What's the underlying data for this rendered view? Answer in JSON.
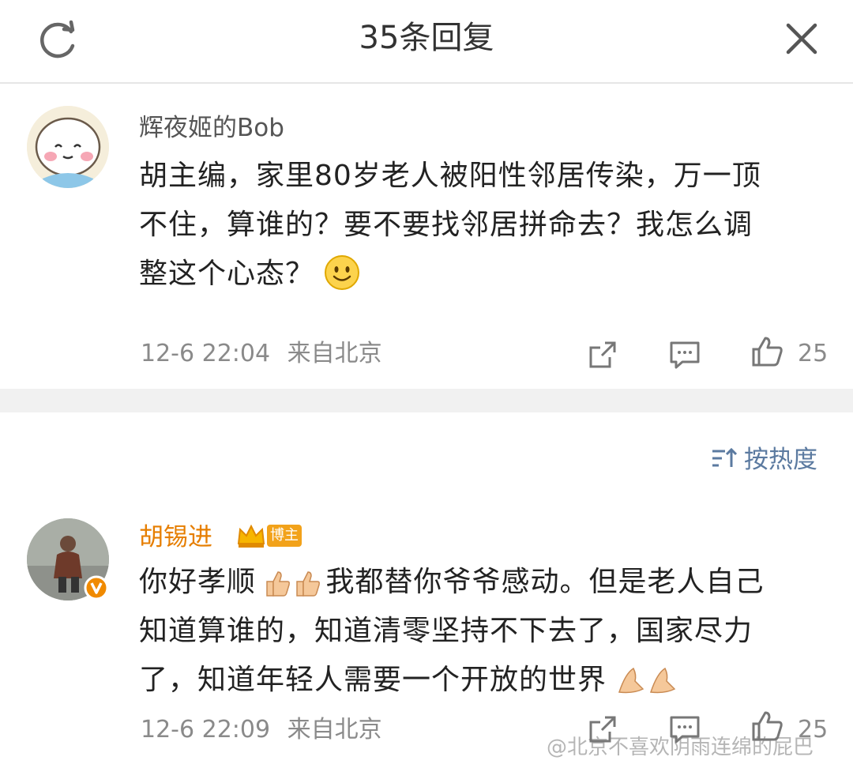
{
  "header": {
    "title": "35条回复",
    "refresh_icon": "refresh-icon",
    "close_icon": "close-icon"
  },
  "comments": [
    {
      "username": "辉夜姬的Bob",
      "text_lines": [
        "胡主编，家里80岁老人被阳性邻居传染，万一顶",
        "不住，算谁的？要不要找邻居拼命去？我怎么调",
        "整这个心态？"
      ],
      "trailing_emoji": "smile-emoji",
      "time": "12-6 22:04",
      "location": "来自北京",
      "likes": "25"
    },
    {
      "username": "胡锡进",
      "badge": "博主",
      "text_lines": [
        "你好孝顺",
        "我都替你爷爷感动。但是老人自己",
        "知道算谁的，知道清零坚持不下去了，国家尽力",
        "了，知道年轻人需要一个开放的世界"
      ],
      "time": "12-6 22:09",
      "location": "来自北京",
      "likes": "25"
    }
  ],
  "sort": {
    "label": "按热度",
    "icon": "sort-icon"
  },
  "watermark": "@北京不喜欢阴雨连绵的屁巴",
  "colors": {
    "vip_name": "#e67e00",
    "meta": "#8a8a8a",
    "sort_link": "#5b7aa0",
    "badge": "#f2a21a"
  }
}
